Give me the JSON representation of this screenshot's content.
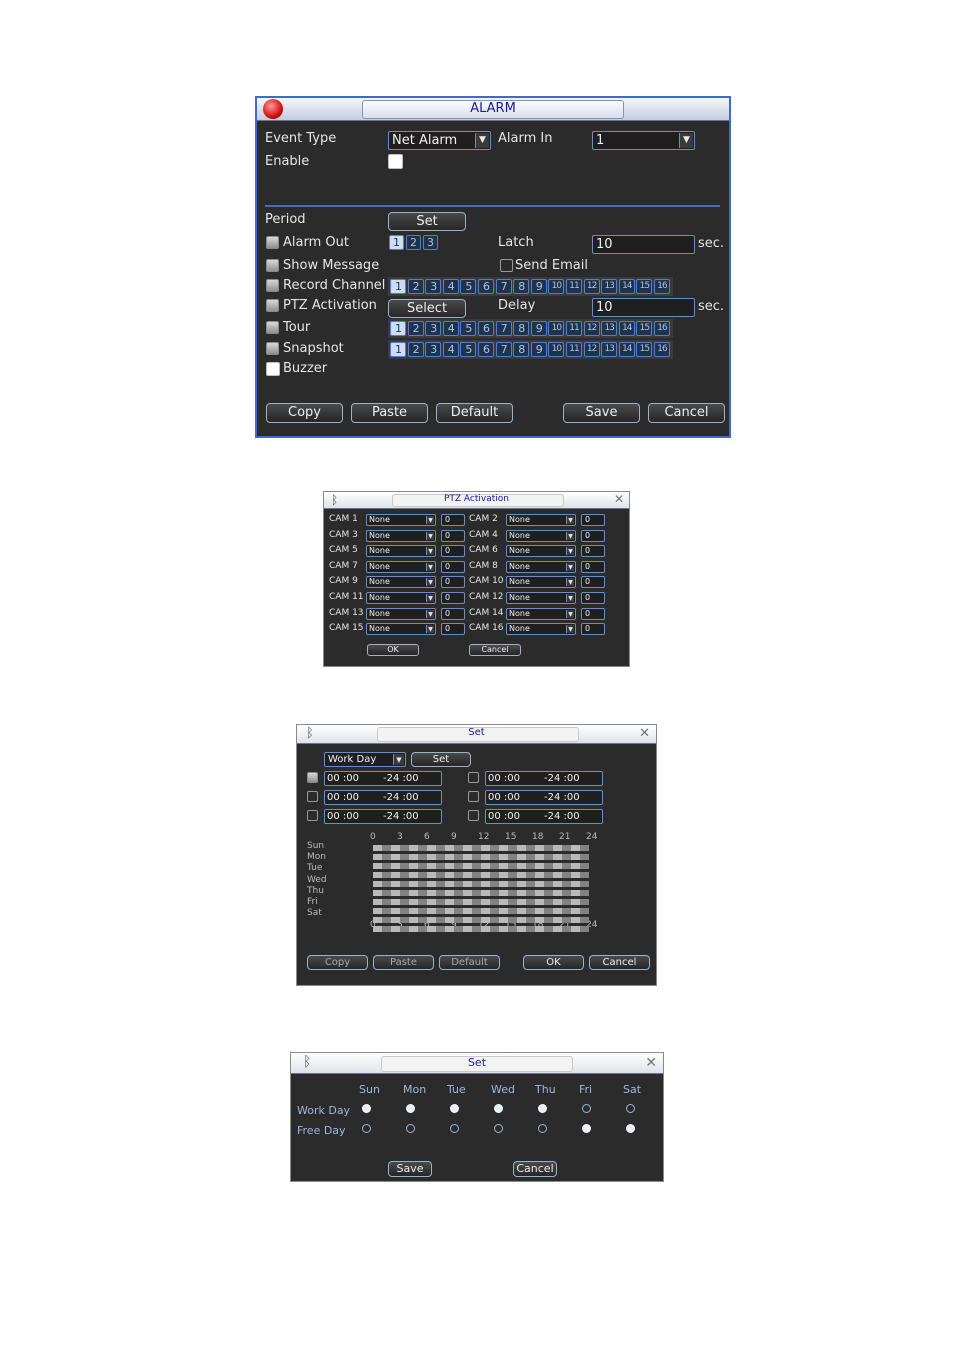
{
  "alarm": {
    "title": "ALARM",
    "event_type_label": "Event Type",
    "event_type_value": "Net Alarm",
    "alarm_in_label": "Alarm In",
    "alarm_in_value": "1",
    "enable_label": "Enable",
    "period_label": "Period",
    "set_button": "Set",
    "alarm_out_label": "Alarm Out",
    "alarm_out_outputs": [
      "1",
      "2",
      "3"
    ],
    "latch_label": "Latch",
    "latch_value": "10",
    "sec_label": "sec.",
    "show_message_label": "Show Message",
    "send_email_label": "Send Email",
    "record_channel_label": "Record Channel",
    "ptz_activation_label": "PTZ Activation",
    "select_button": "Select",
    "delay_label": "Delay",
    "delay_value": "10",
    "tour_label": "Tour",
    "snapshot_label": "Snapshot",
    "buzzer_label": "Buzzer",
    "channels": [
      "1",
      "2",
      "3",
      "4",
      "5",
      "6",
      "7",
      "8",
      "9",
      "10",
      "11",
      "12",
      "13",
      "14",
      "15",
      "16"
    ],
    "buttons": {
      "copy": "Copy",
      "paste": "Paste",
      "default": "Default",
      "save": "Save",
      "cancel": "Cancel"
    }
  },
  "ptz": {
    "title": "PTZ Activation",
    "cams": [
      "CAM 1",
      "CAM 2",
      "CAM 3",
      "CAM 4",
      "CAM 5",
      "CAM 6",
      "CAM 7",
      "CAM 8",
      "CAM 9",
      "CAM 10",
      "CAM 11",
      "CAM 12",
      "CAM 13",
      "CAM 14",
      "CAM 15",
      "CAM 16"
    ],
    "type_value": "None",
    "num_value": "0",
    "ok": "OK",
    "cancel": "Cancel"
  },
  "set_period": {
    "title": "Set",
    "day_value": "Work Day",
    "set_button": "Set",
    "periods": [
      {
        "start": "00 :00",
        "end": "-24 :00"
      },
      {
        "start": "00 :00",
        "end": "-24 :00"
      },
      {
        "start": "00 :00",
        "end": "-24 :00"
      },
      {
        "start": "00 :00",
        "end": "-24 :00"
      },
      {
        "start": "00 :00",
        "end": "-24 :00"
      },
      {
        "start": "00 :00",
        "end": "-24 :00"
      }
    ],
    "hours": [
      "0",
      "3",
      "6",
      "9",
      "12",
      "15",
      "18",
      "21",
      "24"
    ],
    "days": [
      "Sun",
      "Mon",
      "Tue",
      "Wed",
      "Thu",
      "Fri",
      "Sat"
    ],
    "buttons": {
      "copy": "Copy",
      "paste": "Paste",
      "default": "Default",
      "ok": "OK",
      "cancel": "Cancel"
    }
  },
  "set_days": {
    "title": "Set",
    "days": [
      "Sun",
      "Mon",
      "Tue",
      "Wed",
      "Thu",
      "Fri",
      "Sat"
    ],
    "work_label": "Work Day",
    "free_label": "Free Day",
    "work": [
      true,
      true,
      true,
      true,
      true,
      false,
      false
    ],
    "free": [
      false,
      false,
      false,
      false,
      false,
      true,
      true
    ],
    "save": "Save",
    "cancel": "Cancel"
  }
}
